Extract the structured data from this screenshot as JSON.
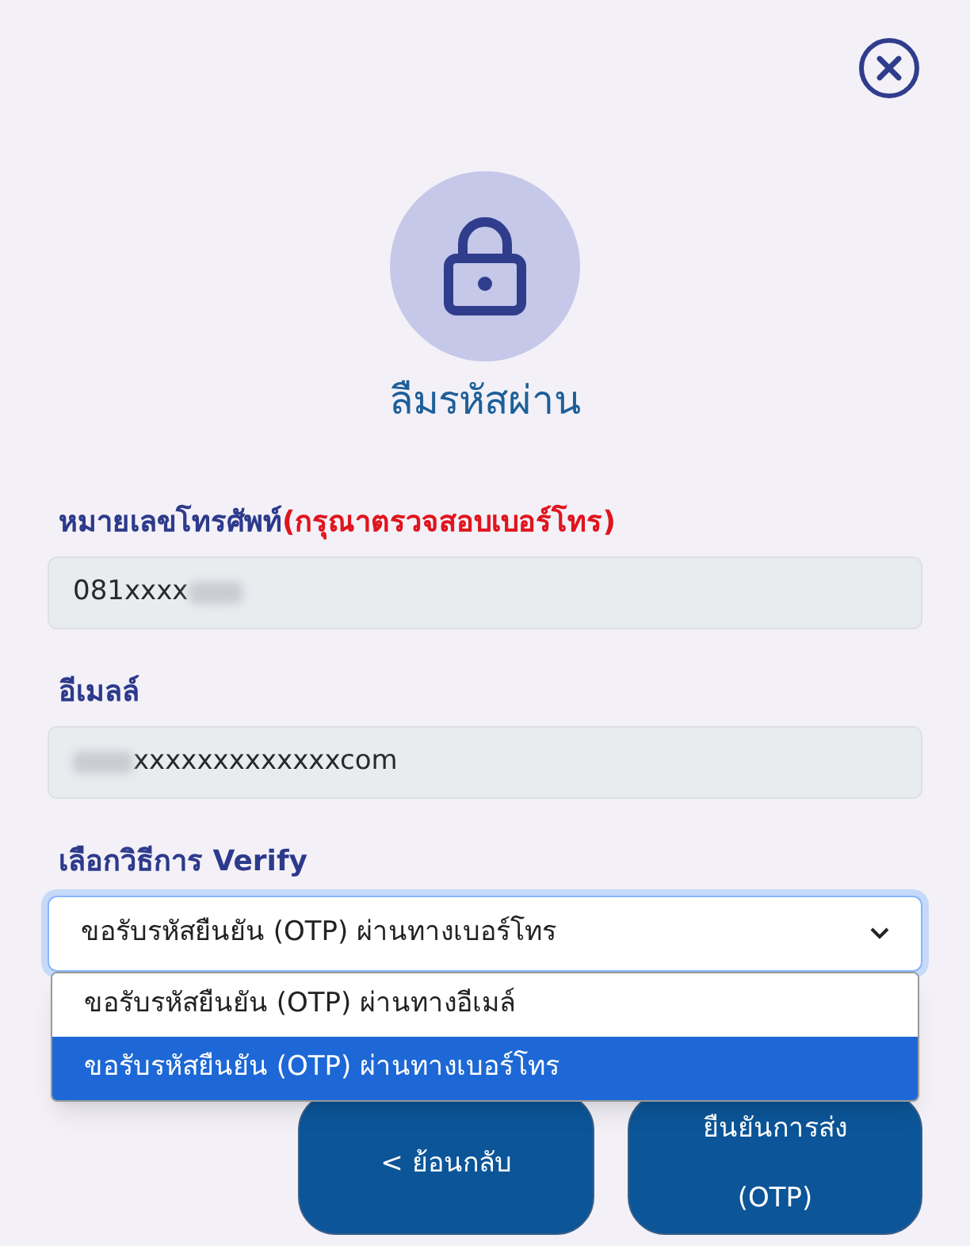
{
  "title": "ลืมรหัสผ่าน",
  "phone": {
    "label": "หมายเลขโทรศัพท์",
    "note": "(กรุณาตรวจสอบเบอร์โทร)",
    "value": "081xxxx"
  },
  "email": {
    "label": "อีเมลล์",
    "value": "xxxxxxxxxxxxxcom"
  },
  "verify": {
    "label": "เลือกวิธีการ Verify",
    "value": "ขอรับรหัสยืนยัน (OTP) ผ่านทางเบอร์โทร",
    "expanded": true,
    "options": [
      {
        "label": "ขอรับรหัสยืนยัน (OTP) ผ่านทางอีเมล์",
        "selected": false
      },
      {
        "label": "ขอรับรหัสยืนยัน (OTP) ผ่านทางเบอร์โทร",
        "selected": true
      }
    ]
  },
  "buttons": [
    {
      "kind": "back",
      "label": "< ย้อนกลับ"
    },
    {
      "kind": "confirm",
      "label": "ยืนยันการส่ง (OTP)"
    }
  ]
}
